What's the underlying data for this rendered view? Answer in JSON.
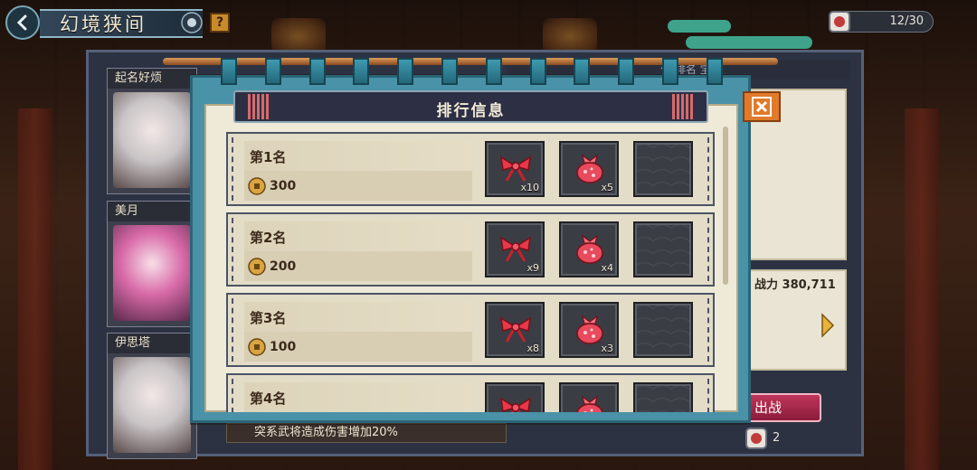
{
  "header": {
    "title": "幻境狭间",
    "help_label": "?",
    "ticket_count": "12/30"
  },
  "characters": [
    {
      "name": "起名好烦"
    },
    {
      "name": "美月"
    },
    {
      "name": "伊思塔"
    }
  ],
  "side": {
    "power_label": "战力",
    "power_value": "380,711",
    "fight_label": "出战",
    "bottom_count": "2",
    "buff_text": "突系武将造成伤害增加20%",
    "tab_strip_text": "化  排名  宝物"
  },
  "modal": {
    "title": "排行信息",
    "rows": [
      {
        "rank": "第1名",
        "coins": "300",
        "ribbon_qty": "x10",
        "bag_qty": "x5"
      },
      {
        "rank": "第2名",
        "coins": "200",
        "ribbon_qty": "x9",
        "bag_qty": "x4"
      },
      {
        "rank": "第3名",
        "coins": "100",
        "ribbon_qty": "x8",
        "bag_qty": "x3"
      },
      {
        "rank": "第4名",
        "coins": "",
        "ribbon_qty": "",
        "bag_qty": ""
      }
    ]
  },
  "icons": {
    "back": "back-arrow-icon",
    "close": "close-icon",
    "coin": "coin-icon",
    "ribbon": "ribbon-icon",
    "bag": "lucky-bag-icon",
    "ticket": "ticket-icon"
  },
  "colors": {
    "modal_frame": "#4a92a8",
    "header_plate": "#2d2f44",
    "close_button": "#e07a2a",
    "fight_button": "#c0355a"
  }
}
